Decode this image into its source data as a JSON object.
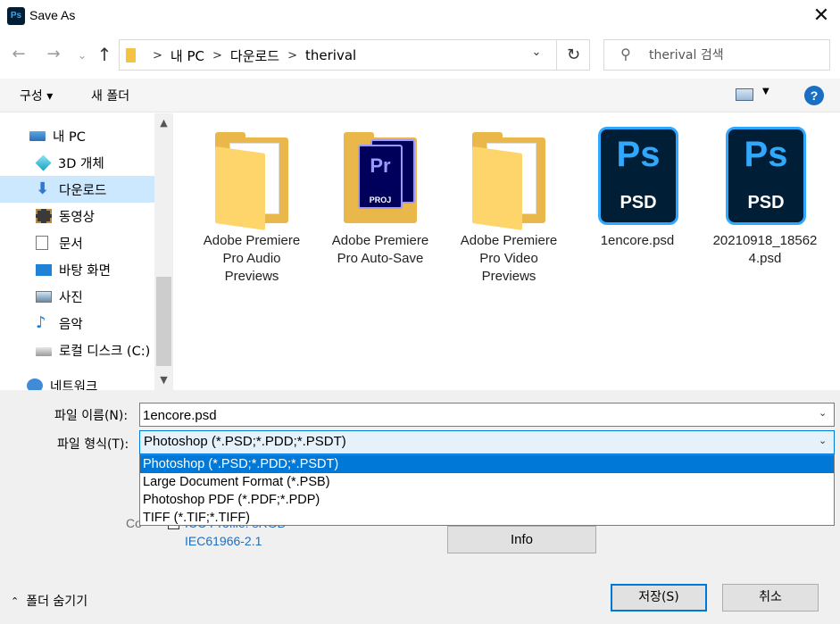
{
  "window": {
    "title": "Save As",
    "app_icon": "Ps"
  },
  "address": {
    "crumbs": [
      "내 PC",
      "다운로드",
      "therival"
    ],
    "search_placeholder": "therival 검색"
  },
  "toolbar": {
    "organize": "구성 ▾",
    "new_folder": "새 폴더",
    "help": "?"
  },
  "sidebar": {
    "items": [
      {
        "label": "내 PC",
        "icon": "pc-icon"
      },
      {
        "label": "3D 개체",
        "icon": "3d-objects-icon"
      },
      {
        "label": "다운로드",
        "icon": "download-icon",
        "selected": true
      },
      {
        "label": "동영상",
        "icon": "video-icon"
      },
      {
        "label": "문서",
        "icon": "document-icon"
      },
      {
        "label": "바탕 화면",
        "icon": "desktop-icon"
      },
      {
        "label": "사진",
        "icon": "pictures-icon"
      },
      {
        "label": "음악",
        "icon": "music-icon"
      },
      {
        "label": "로컬 디스크 (C:)",
        "icon": "drive-icon"
      },
      {
        "label": "네트워크",
        "icon": "network-icon"
      }
    ]
  },
  "files": [
    {
      "name": "Adobe Premiere Pro Audio Previews",
      "type": "folder"
    },
    {
      "name": "Adobe Premiere Pro Auto-Save",
      "type": "premiere-folder",
      "badge": "Pr",
      "badge_sub": "PROJ"
    },
    {
      "name": "Adobe Premiere Pro Video Previews",
      "type": "folder"
    },
    {
      "name": "1encore.psd",
      "type": "psd",
      "badge": "Ps",
      "ext": "PSD"
    },
    {
      "name": "20210918_185624.psd",
      "type": "psd",
      "badge": "Ps",
      "ext": "PSD"
    }
  ],
  "form": {
    "filename_label": "파일 이름(N):",
    "filename_value": "1encore.psd",
    "filetype_label": "파일 형식(T):",
    "filetype_value": "Photoshop (*.PSD;*.PDD;*.PSDT)",
    "filetype_options": [
      "Photoshop (*.PSD;*.PDD;*.PSDT)",
      "Large Document Format (*.PSB)",
      "Photoshop PDF (*.PDF;*.PDP)",
      "TIFF (*.TIF;*.TIFF)"
    ],
    "color_label": "Co",
    "color_link_partial": "ICC Profile: sRGB",
    "iec_link": "IEC61966-2.1",
    "info_button": "Info"
  },
  "footer": {
    "hide_folders": "폴더 숨기기",
    "save": "저장(S)",
    "cancel": "취소"
  },
  "colors": {
    "accent": "#0078d7",
    "selected_nav": "#cce8ff",
    "psd_bg": "#001e36",
    "psd_blue": "#31a8ff",
    "folder": "#f5c342"
  }
}
